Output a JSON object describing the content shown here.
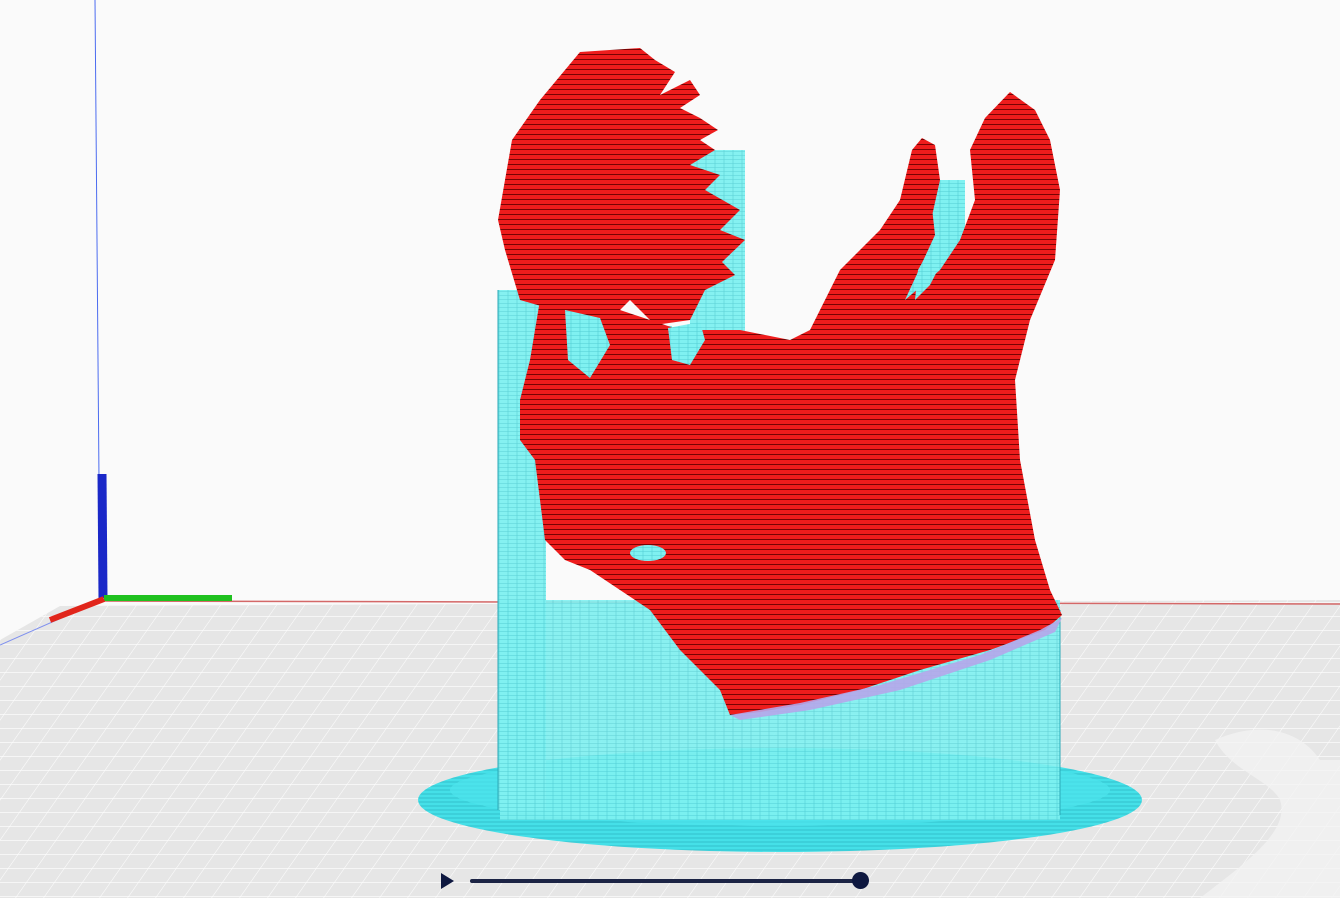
{
  "app": {
    "title": ""
  },
  "viewport": {
    "background_color": "#fafafa",
    "floor_color": "#e6e6e6",
    "grid_color": "#ffffff"
  },
  "axes": {
    "x_color": "#e1251b",
    "y_color": "#1fc11f",
    "z_color": "#1a28c8"
  },
  "model": {
    "color": "#ee1c1c",
    "layer_line_color": "#6b0000"
  },
  "support": {
    "color": "#7ff1f1",
    "line_color": "#47c7cf",
    "brim_color": "#45e0e8"
  },
  "simulation": {
    "play_icon": "play-icon",
    "progress": 1.0,
    "accent": "#0e1840"
  }
}
